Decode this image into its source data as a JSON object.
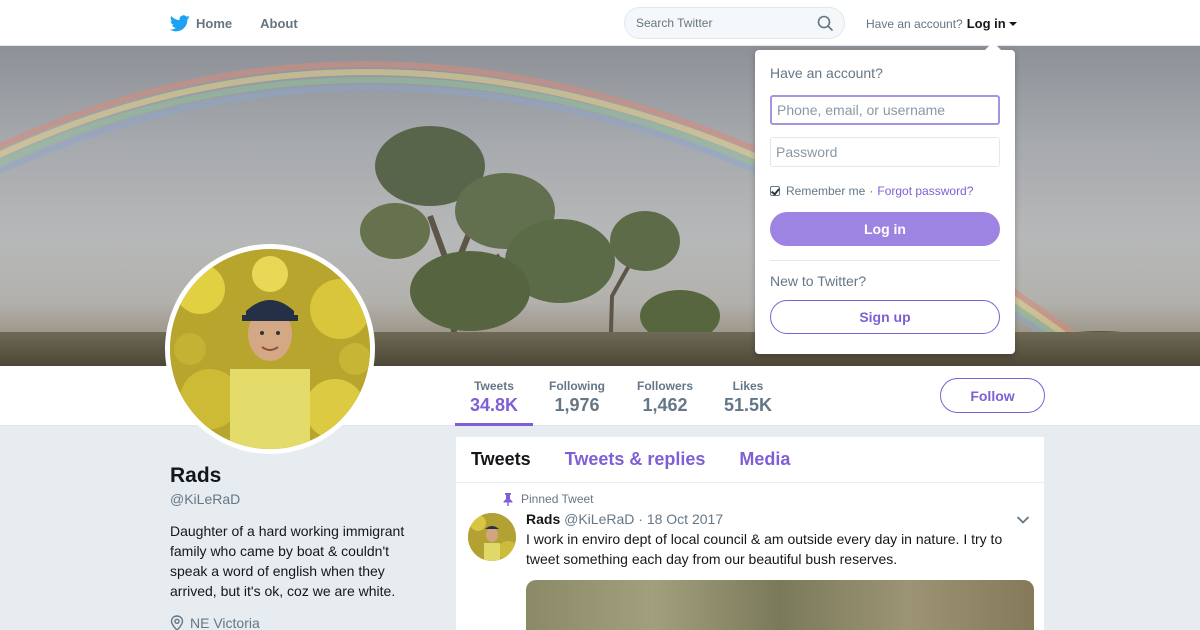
{
  "nav": {
    "home_label": "Home",
    "about_label": "About",
    "search_placeholder": "Search Twitter",
    "have_account": "Have an account?",
    "login_label": "Log in",
    "brand_color": "#1da1f2"
  },
  "profile": {
    "name": "Rads",
    "handle": "@KiLeRaD",
    "bio": "Daughter of a hard working immigrant family who came by boat & couldn't speak a word of english when they arrived, but it's ok, coz we are white.",
    "location": "NE Victoria",
    "accent_color": "#7f5fd6"
  },
  "stats": [
    {
      "label": "Tweets",
      "value": "34.8K",
      "active": true
    },
    {
      "label": "Following",
      "value": "1,976",
      "active": false
    },
    {
      "label": "Followers",
      "value": "1,462",
      "active": false
    },
    {
      "label": "Likes",
      "value": "51.5K",
      "active": false
    }
  ],
  "follow_label": "Follow",
  "timeline": {
    "tabs": [
      "Tweets",
      "Tweets & replies",
      "Media"
    ],
    "pinned_label": "Pinned Tweet",
    "tweet": {
      "name": "Rads",
      "handle": "@KiLeRaD",
      "date": "18 Oct 2017",
      "text": "I work in enviro dept of local council & am outside every day in nature. I try to tweet something each day from our beautiful bush reserves."
    }
  },
  "login_dropdown": {
    "title": "Have an account?",
    "username_placeholder": "Phone, email, or username",
    "password_placeholder": "Password",
    "remember_label": "Remember me",
    "separator": "·",
    "forgot_label": "Forgot password?",
    "login_button": "Log in",
    "new_label": "New to Twitter?",
    "signup_button": "Sign up"
  }
}
